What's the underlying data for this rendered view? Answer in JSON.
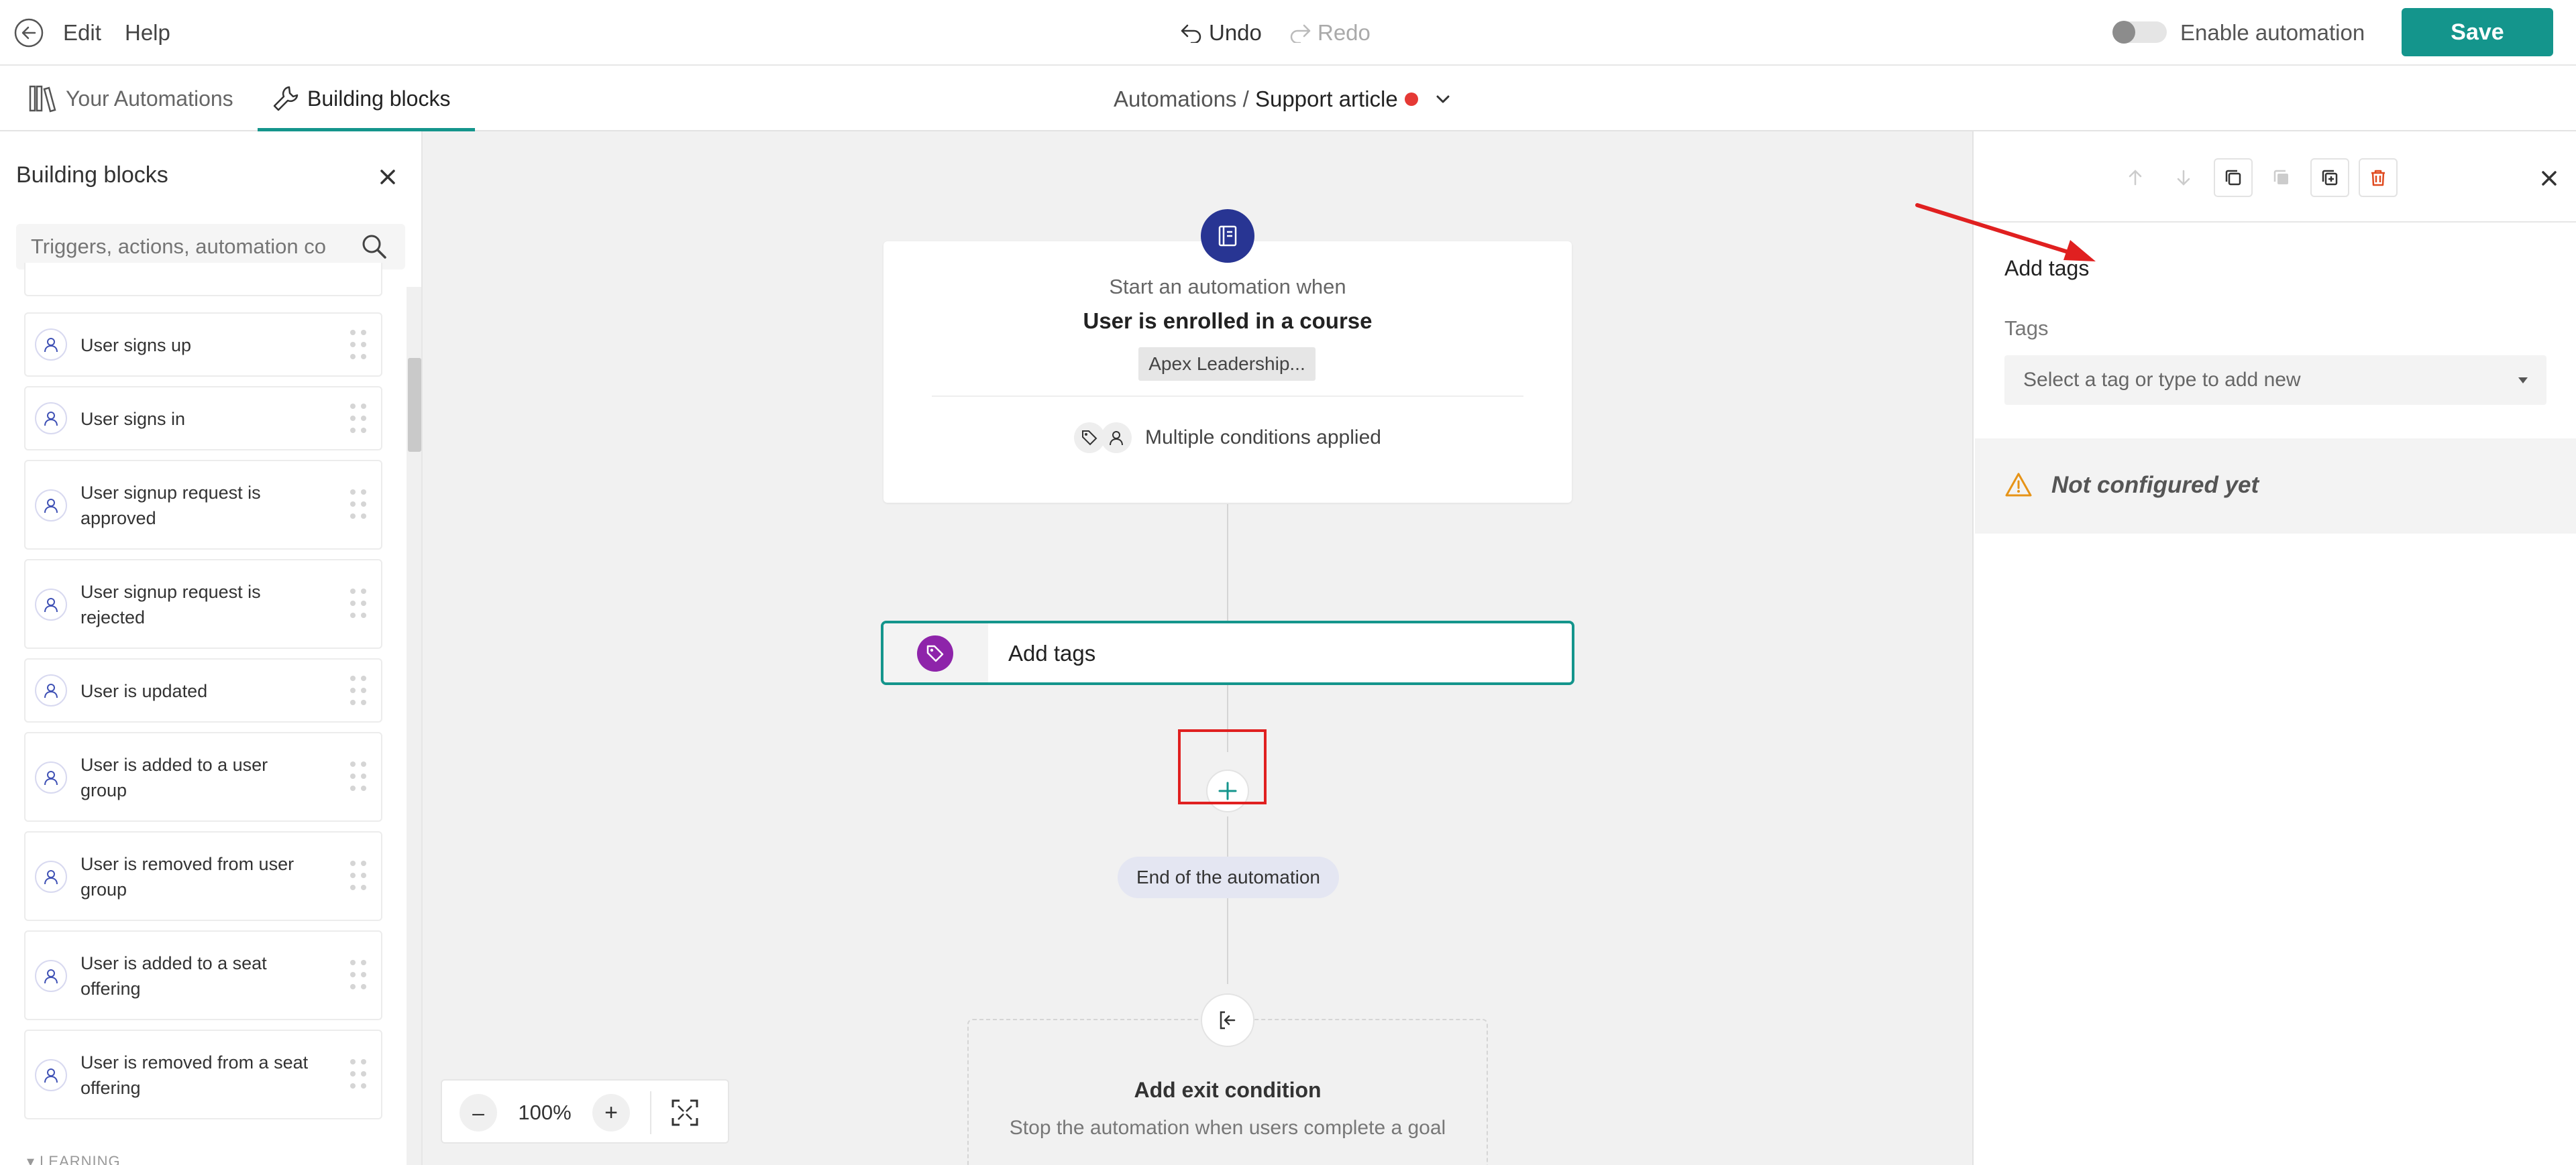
{
  "topbar": {
    "edit_label": "Edit",
    "help_label": "Help",
    "undo_label": "Undo",
    "redo_label": "Redo",
    "enable_automation_label": "Enable automation",
    "enable_automation_on": false,
    "save_label": "Save"
  },
  "tabs": {
    "your_automations": "Your Automations",
    "building_blocks": "Building blocks",
    "active": "Building blocks"
  },
  "breadcrumb": {
    "root": "Automations",
    "separator": " / ",
    "current": "Support article"
  },
  "left_panel": {
    "title": "Building blocks",
    "search_placeholder": "Triggers, actions, automation co",
    "items": [
      {
        "label": "User signs up"
      },
      {
        "label": "User signs in"
      },
      {
        "label": "User signup request is approved"
      },
      {
        "label": "User signup request is rejected"
      },
      {
        "label": "User is updated"
      },
      {
        "label": "User is added to a user group"
      },
      {
        "label": "User is removed from user group"
      },
      {
        "label": "User is added to a seat offering"
      },
      {
        "label": "User is removed from a seat offering"
      }
    ],
    "section_label": "LEARNING"
  },
  "canvas": {
    "trigger_card": {
      "subtitle": "Start an automation when",
      "title": "User is enrolled in a course",
      "course_chip": "Apex Leadership...",
      "conditions_label": "Multiple conditions applied"
    },
    "action_card": {
      "label": "Add tags"
    },
    "end_label": "End of the automation",
    "exit_card": {
      "title": "Add exit condition",
      "subtitle": "Stop the automation when users complete a goal"
    },
    "zoom": {
      "level": "100%",
      "minus": "–",
      "plus": "+"
    }
  },
  "right_panel": {
    "title": "Add tags",
    "tags_label": "Tags",
    "tags_placeholder": "Select a tag or type to add new",
    "warning_label": "Not configured yet"
  },
  "colors": {
    "accent": "#14958c",
    "error_dot": "#e53935",
    "tag_icon_bg": "#8e24aa",
    "trigger_icon_bg": "#283593",
    "warning": "#e69317",
    "annotation_red": "#e02020"
  }
}
